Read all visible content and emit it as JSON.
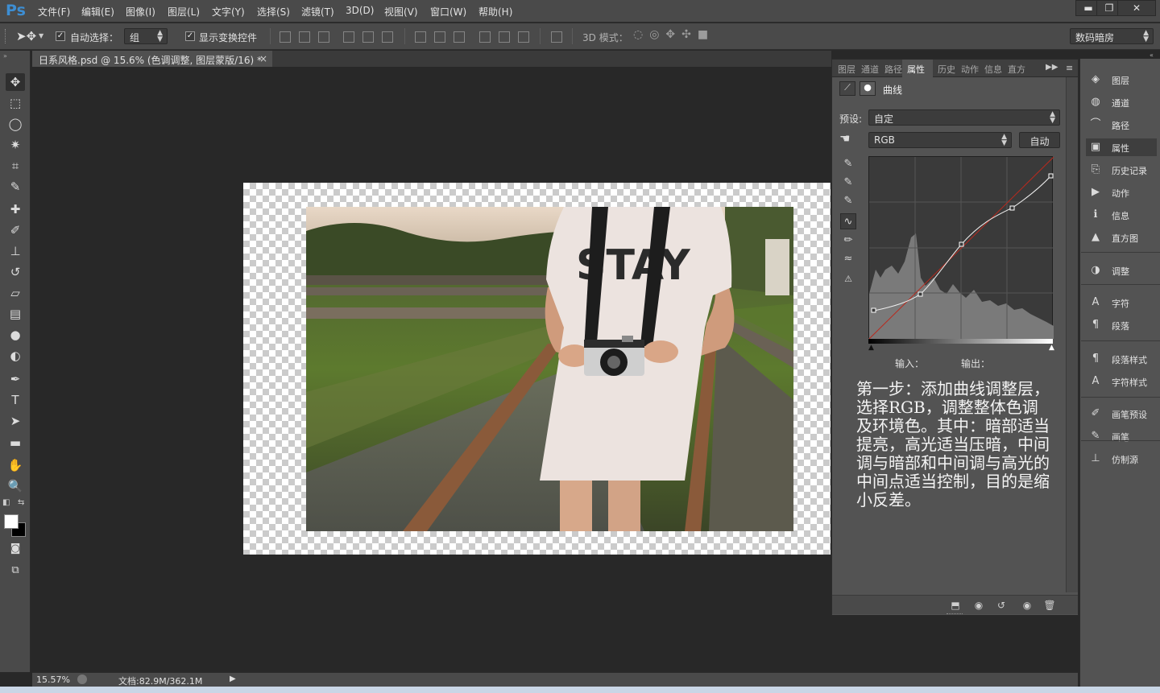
{
  "app": {
    "logo": "Ps"
  },
  "menu": [
    "文件(F)",
    "编辑(E)",
    "图像(I)",
    "图层(L)",
    "文字(Y)",
    "选择(S)",
    "滤镜(T)",
    "3D(D)",
    "视图(V)",
    "窗口(W)",
    "帮助(H)"
  ],
  "window_controls": {
    "minimize": "▬",
    "restore": "❐",
    "close": "✕"
  },
  "options": {
    "auto_select_label": "自动选择：",
    "auto_select_checked": true,
    "auto_select_value": "组",
    "show_transform_label": "显示变换控件",
    "show_transform_checked": true,
    "mode_3d_label": "3D 模式：",
    "workspace": "数码暗房"
  },
  "document": {
    "tab_title": "日系风格.psd @ 15.6% (色调调整, 图层蒙版/16) *",
    "tab_close": "×",
    "shirt_text": "STAY"
  },
  "status": {
    "zoom": "15.57%",
    "doc_size": "文档:82.9M/362.1M",
    "play_icon": "▶"
  },
  "tools": [
    {
      "name": "move-tool",
      "glyph": "✥"
    },
    {
      "name": "marquee-tool",
      "glyph": "⬚"
    },
    {
      "name": "lasso-tool",
      "glyph": "◯"
    },
    {
      "name": "magic-wand-tool",
      "glyph": "✷"
    },
    {
      "name": "crop-tool",
      "glyph": "⌗"
    },
    {
      "name": "eyedropper-tool",
      "glyph": "✎"
    },
    {
      "name": "healing-brush-tool",
      "glyph": "✚"
    },
    {
      "name": "brush-tool",
      "glyph": "✐"
    },
    {
      "name": "clone-stamp-tool",
      "glyph": "⊥"
    },
    {
      "name": "history-brush-tool",
      "glyph": "↺"
    },
    {
      "name": "eraser-tool",
      "glyph": "▱"
    },
    {
      "name": "gradient-tool",
      "glyph": "▤"
    },
    {
      "name": "blur-tool",
      "glyph": "●"
    },
    {
      "name": "dodge-tool",
      "glyph": "◐"
    },
    {
      "name": "pen-tool",
      "glyph": "✒"
    },
    {
      "name": "type-tool",
      "glyph": "T"
    },
    {
      "name": "path-selection-tool",
      "glyph": "➤"
    },
    {
      "name": "shape-tool",
      "glyph": "▬"
    },
    {
      "name": "hand-tool",
      "glyph": "✋"
    },
    {
      "name": "zoom-tool",
      "glyph": "🔍"
    }
  ],
  "properties": {
    "tabs": [
      "图层",
      "通道",
      "路径",
      "属性",
      "历史",
      "动作",
      "信息",
      "直方"
    ],
    "active_tab": "属性",
    "title": "曲线",
    "preset_label": "预设:",
    "preset_value": "自定",
    "channel_value": "RGB",
    "auto_button": "自动",
    "input_label": "输入：",
    "output_label": "输出："
  },
  "annotation": "第一步：添加曲线调整层，选择RGB，调整整体色调及环境色。其中：暗部适当提亮，高光适当压暗，中间调与暗部和中间调与高光的中间点适当控制，目的是缩小反差。",
  "dock": [
    {
      "label": "图层",
      "icon": "layers-icon",
      "glyph": "◈"
    },
    {
      "label": "通道",
      "icon": "channels-icon",
      "glyph": "◍"
    },
    {
      "label": "路径",
      "icon": "paths-icon",
      "glyph": "⌒"
    },
    {
      "label": "属性",
      "icon": "properties-icon",
      "glyph": "▣"
    },
    {
      "label": "历史记录",
      "icon": "history-icon",
      "glyph": "⎘"
    },
    {
      "label": "动作",
      "icon": "actions-icon",
      "glyph": "▶"
    },
    {
      "label": "信息",
      "icon": "info-icon",
      "glyph": "ℹ"
    },
    {
      "label": "直方图",
      "icon": "histogram-icon",
      "glyph": "▲"
    },
    {
      "label": "调整",
      "icon": "adjustments-icon",
      "glyph": "◑"
    },
    {
      "label": "字符",
      "icon": "character-icon",
      "glyph": "A"
    },
    {
      "label": "段落",
      "icon": "paragraph-icon",
      "glyph": "¶"
    },
    {
      "label": "段落样式",
      "icon": "paragraph-styles-icon",
      "glyph": "¶"
    },
    {
      "label": "字符样式",
      "icon": "character-styles-icon",
      "glyph": "A"
    },
    {
      "label": "画笔预设",
      "icon": "brush-presets-icon",
      "glyph": "✐"
    },
    {
      "label": "画笔",
      "icon": "brush-icon",
      "glyph": "✎"
    },
    {
      "label": "仿制源",
      "icon": "clone-source-icon",
      "glyph": "⊥"
    }
  ],
  "colors": {
    "ps_blue": "#3d8ed3",
    "panel": "#535353",
    "chrome": "#4a4a4a",
    "canvas": "#282828",
    "curve_red": "#c0392b"
  }
}
